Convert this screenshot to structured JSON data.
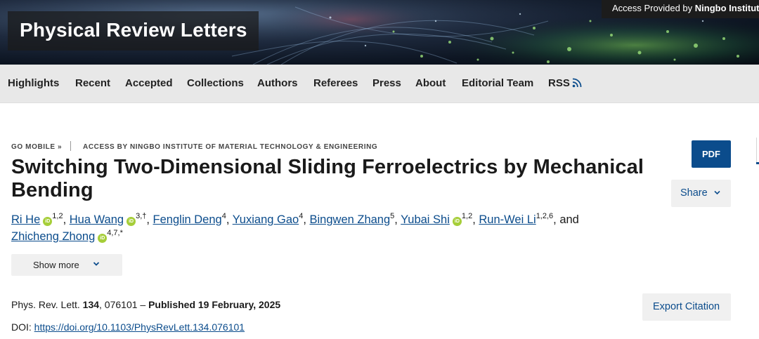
{
  "header": {
    "journal_title": "Physical Review Letters",
    "access_prefix": "Access Provided by",
    "access_institution": "Ningbo Institute"
  },
  "nav": {
    "items": [
      {
        "label": "Highlights"
      },
      {
        "label": "Recent"
      },
      {
        "label": "Accepted"
      },
      {
        "label": "Collections"
      },
      {
        "label": "Authors"
      },
      {
        "label": "Referees"
      },
      {
        "label": "Press"
      },
      {
        "label": "About"
      },
      {
        "label": "Editorial Team"
      },
      {
        "label": "RSS"
      }
    ],
    "rss_icon": "rss-icon"
  },
  "meta": {
    "go_mobile": "GO MOBILE »",
    "access_by": "ACCESS BY NINGBO INSTITUTE OF MATERIAL TECHNOLOGY & ENGINEERING"
  },
  "article": {
    "title": "Switching Two-Dimensional Sliding Ferroelectrics by Mechanical Bending",
    "authors": [
      {
        "name": "Ri He",
        "orcid": true,
        "sup": "1,2",
        "sep": ", "
      },
      {
        "name": "Hua Wang",
        "orcid": true,
        "sup": "3,†",
        "sep": ", "
      },
      {
        "name": "Fenglin Deng",
        "orcid": false,
        "sup": "4",
        "sep": ", "
      },
      {
        "name": "Yuxiang Gao",
        "orcid": false,
        "sup": "4",
        "sep": ", "
      },
      {
        "name": "Bingwen Zhang",
        "orcid": false,
        "sup": "5",
        "sep": ", "
      },
      {
        "name": "Yubai Shi",
        "orcid": true,
        "sup": "1,2",
        "sep": ", "
      },
      {
        "name": "Run-Wei Li",
        "orcid": false,
        "sup": "1,2,6",
        "sep": ", and "
      },
      {
        "name": "Zhicheng Zhong",
        "orcid": true,
        "sup": "4,7,*",
        "sep": ""
      }
    ],
    "orcid_badge": "iD",
    "journal_abbrev": "Phys. Rev. Lett.",
    "volume": "134",
    "article_number": ", 076101 – ",
    "published": "Published 19 February, 2025",
    "doi_label": "DOI:",
    "doi_url": "https://doi.org/10.1103/PhysRevLett.134.076101"
  },
  "buttons": {
    "show_more": "Show more",
    "pdf": "PDF",
    "share": "Share",
    "export_citation": "Export Citation"
  },
  "colors": {
    "link": "#0b4c8c",
    "pdf_button": "#0b4c8c",
    "orcid": "#a6ce39",
    "nav_bg": "#e8e8e8"
  }
}
